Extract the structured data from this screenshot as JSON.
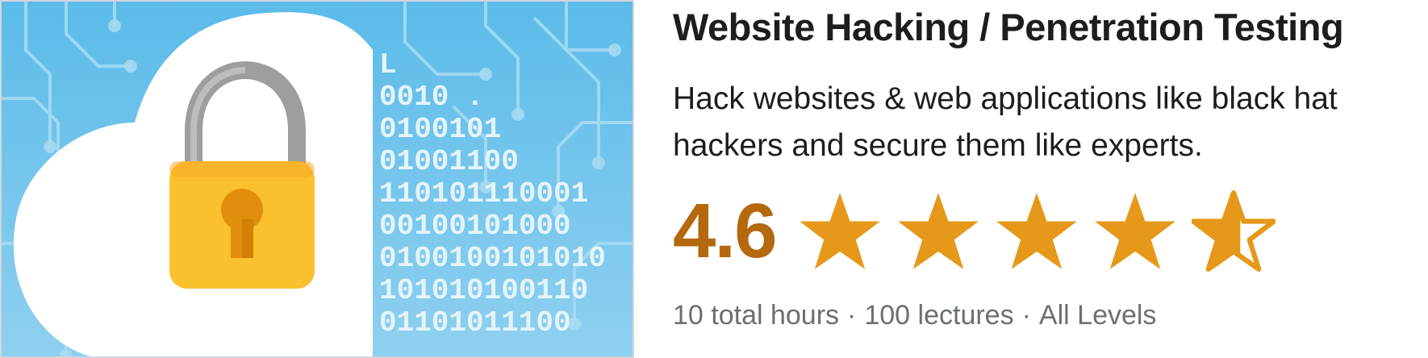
{
  "course": {
    "title": "Website Hacking / Penetration Testing",
    "headline": "Hack websites & web applications like black hat hackers and secure them like experts.",
    "rating": "4.6",
    "rating_value": 4.6,
    "rating_max": 5,
    "meta": {
      "hours": "10 total hours",
      "lectures": "100 lectures",
      "level": "All Levels",
      "separator": "·"
    }
  },
  "thumbnail": {
    "binary_lines": [
      "L",
      "0010 .",
      "0100101",
      "01001100",
      "110101110001",
      "00100101000",
      "0100100101010",
      "101010100110",
      "01101011100"
    ],
    "icon": "padlock-icon"
  },
  "colors": {
    "title": "#1c1d1f",
    "rating": "#b4690e",
    "star": "#e59819",
    "meta": "#6a6f73",
    "thumb_bg": "#7cc8ec",
    "lock_body": "#fbc02d",
    "lock_shackle": "#9e9e9e"
  }
}
